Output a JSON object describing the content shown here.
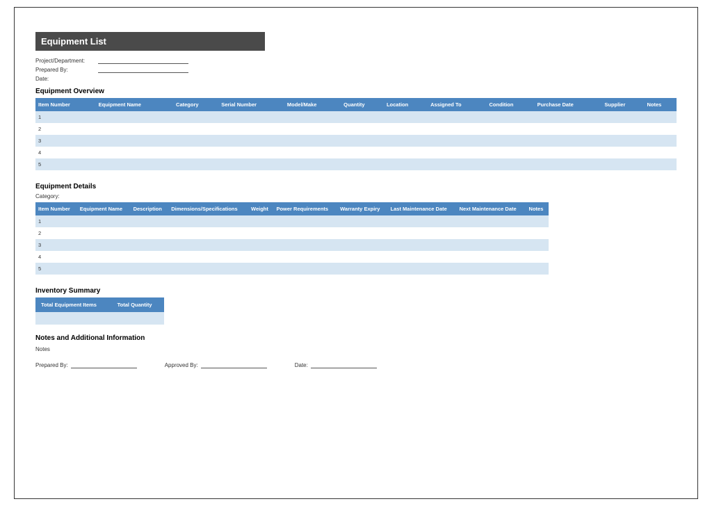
{
  "title": "Equipment List",
  "header_fields": {
    "project": "Project/Department:",
    "prepared_by": "Prepared By:",
    "date": "Date:"
  },
  "sections": {
    "overview_heading": "Equipment Overview",
    "details_heading": "Equipment Details",
    "category_label": "Category:",
    "summary_heading": "Inventory Summary",
    "notes_heading": "Notes and Additional Information",
    "notes_label": "Notes"
  },
  "overview": {
    "columns": [
      "Item Number",
      "Equipment Name",
      "Category",
      "Serial Number",
      "Model/Make",
      "Quantity",
      "Location",
      "Assigned To",
      "Condition",
      "Purchase Date",
      "Supplier",
      "Notes"
    ],
    "rows": [
      "1",
      "2",
      "3",
      "4",
      "5"
    ]
  },
  "details": {
    "columns": [
      "Item Number",
      "Equipment Name",
      "Description",
      "Dimensions/Specifications",
      "Weight",
      "Power Requirements",
      "Warranty Expiry",
      "Last Maintenance Date",
      "Next Maintenance Date",
      "Notes"
    ],
    "rows": [
      "1",
      "2",
      "3",
      "4",
      "5"
    ]
  },
  "summary": {
    "columns": [
      "Total Equipment Items",
      "Total Quantity"
    ]
  },
  "signoff": {
    "prepared_by": "Prepared By:",
    "approved_by": "Approved By:",
    "date": "Date:"
  }
}
